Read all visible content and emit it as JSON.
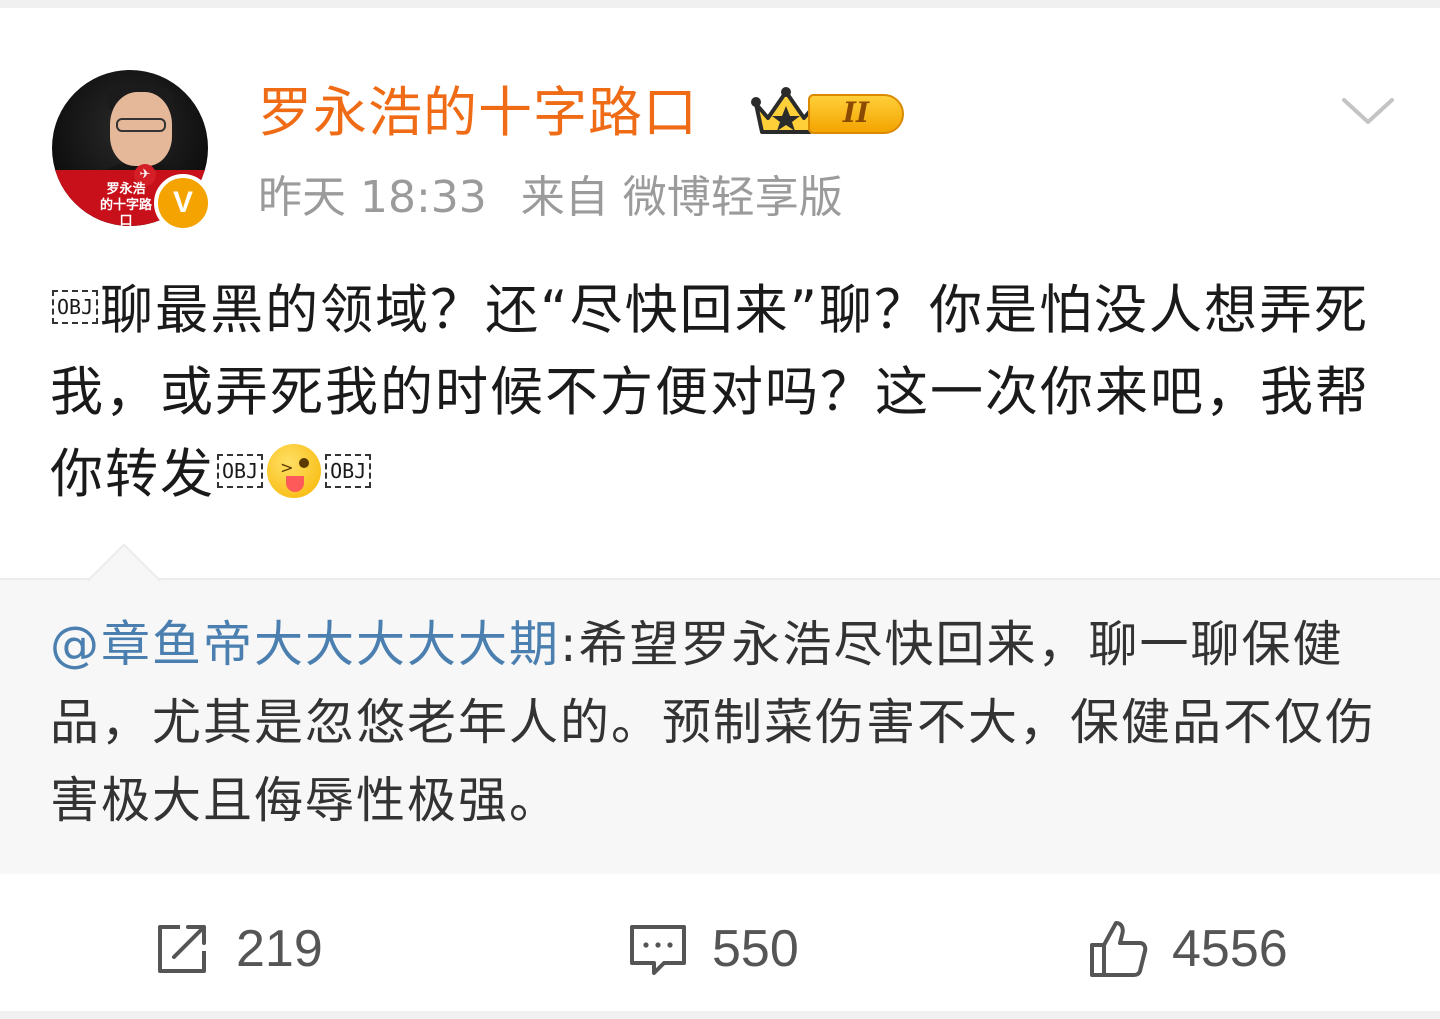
{
  "post": {
    "author": {
      "name": "罗永浩的十字路口",
      "avatar_caption": "罗永浩\n的十字路口",
      "verified_label": "V",
      "level_label": "II"
    },
    "time": "昨天 18:33",
    "source": "来自 微博轻享版",
    "text_part1": "聊最黑的领域？还“尽快回来”聊？你是怕没人想弄死我，或弄死我的时候不方便对吗？这一次你来吧，我帮你转发",
    "obj_placeholder": "OBJ",
    "emoji_name": "tongue-out-emoji"
  },
  "retweet": {
    "author": "@章鱼帝大大大大大期",
    "text": ":希望罗永浩尽快回来，聊一聊保健品，尤其是忽悠老年人的。预制菜伤害不大，保健品不仅伤害极大且侮辱性极强。"
  },
  "actions": {
    "repost": {
      "icon": "share-icon",
      "count": "219"
    },
    "comment": {
      "icon": "comment-icon",
      "count": "550"
    },
    "like": {
      "icon": "thumbs-up-icon",
      "count": "4556"
    }
  },
  "colors": {
    "username": "#f06b15",
    "meta": "#9b9b9b",
    "mention": "#4a7fb0",
    "verified": "#f5a300"
  }
}
